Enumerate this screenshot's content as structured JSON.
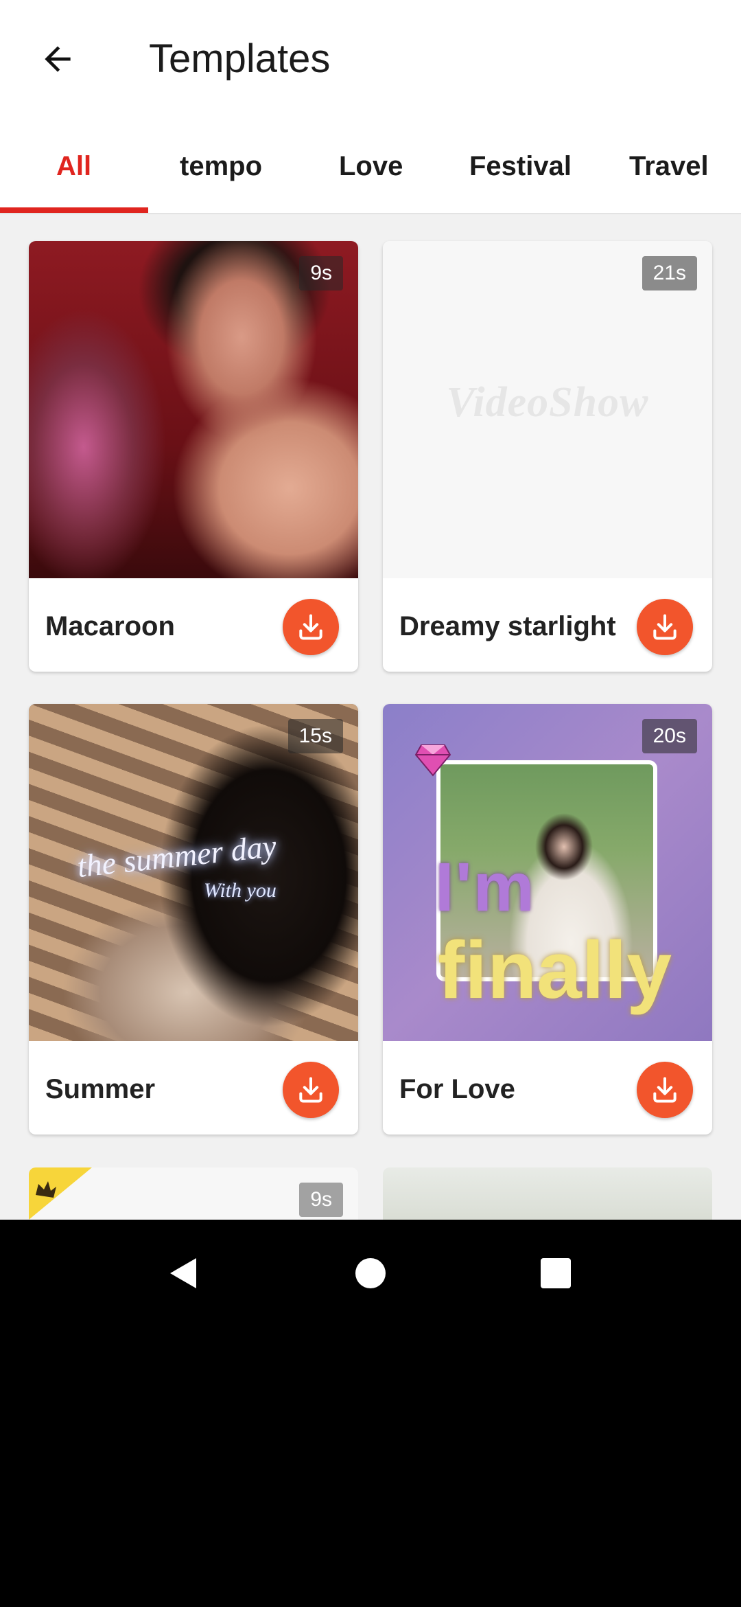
{
  "header": {
    "title": "Templates",
    "back_icon": "arrow-left-icon"
  },
  "tabs": [
    {
      "label": "All",
      "active": true
    },
    {
      "label": "tempo",
      "active": false
    },
    {
      "label": "Love",
      "active": false
    },
    {
      "label": "Festival",
      "active": false
    },
    {
      "label": "Travel",
      "active": false
    }
  ],
  "cards": [
    {
      "title": "Macaroon",
      "duration": "9s",
      "action_icon": "download-icon"
    },
    {
      "title": "Dreamy starlight",
      "duration": "21s",
      "action_icon": "download-icon",
      "watermark": "VideoShow"
    },
    {
      "title": "Summer",
      "duration": "15s",
      "action_icon": "download-icon",
      "overlay_text_1": "the summer day",
      "overlay_text_2": "With you"
    },
    {
      "title": "For Love",
      "duration": "20s",
      "action_icon": "download-icon",
      "overlay_text_1": "I'm",
      "overlay_text_2": "finally"
    }
  ],
  "partial_cards": [
    {
      "duration": "9s",
      "badge_icon": "crown-icon"
    },
    {}
  ],
  "system_nav": {
    "back_icon": "triangle-back-icon",
    "home_icon": "circle-home-icon",
    "recents_icon": "square-recents-icon"
  },
  "colors": {
    "accent": "#e0251f",
    "download_button": "#f2552c"
  }
}
